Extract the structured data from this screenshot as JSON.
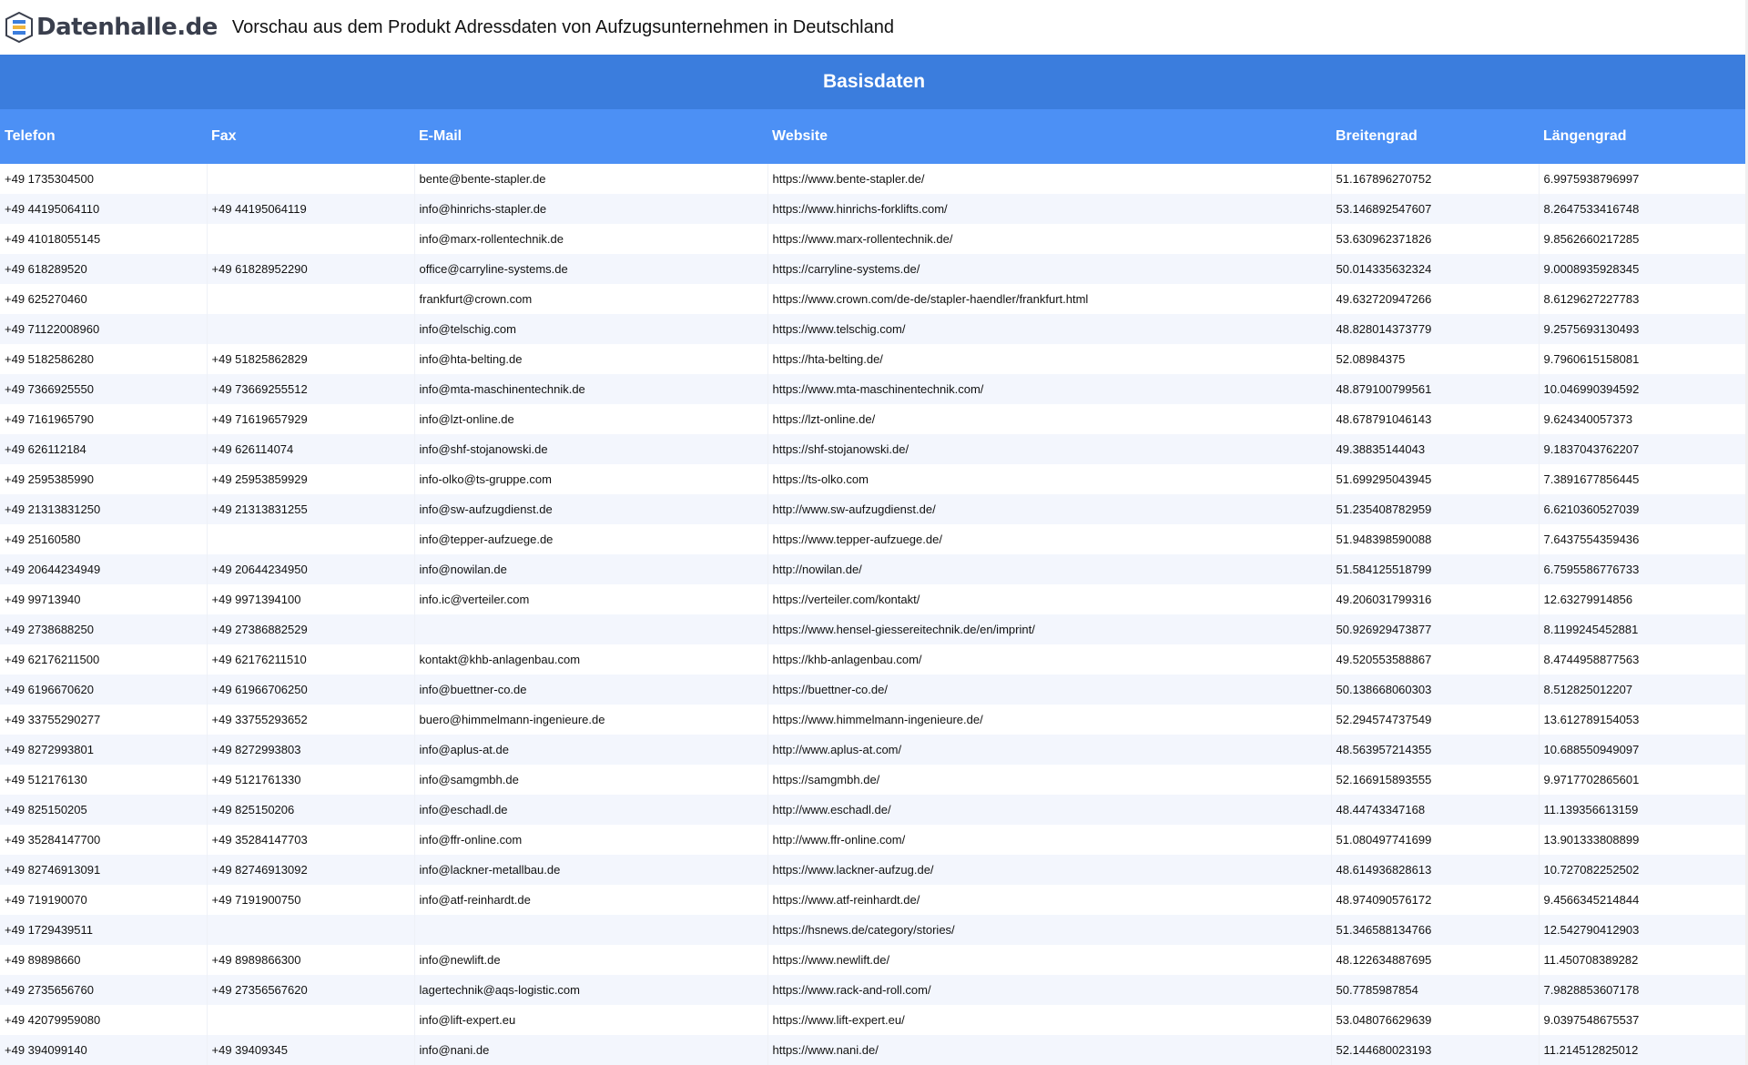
{
  "header": {
    "logo_text": "Datenhalle.de",
    "title": "Vorschau aus dem Produkt Adressdaten von Aufzugsunternehmen in Deutschland"
  },
  "section_title": "Basisdaten",
  "columns": [
    "Telefon",
    "Fax",
    "E-Mail",
    "Website",
    "Breitengrad",
    "Längengrad"
  ],
  "rows": [
    [
      "+49 1735304500",
      "",
      "bente@bente-stapler.de",
      "https://www.bente-stapler.de/",
      "51.167896270752",
      "6.9975938796997"
    ],
    [
      "+49 44195064110",
      "+49 44195064119",
      "info@hinrichs-stapler.de",
      "https://www.hinrichs-forklifts.com/",
      "53.146892547607",
      "8.2647533416748"
    ],
    [
      "+49 41018055145",
      "",
      "info@marx-rollentechnik.de",
      "https://www.marx-rollentechnik.de/",
      "53.630962371826",
      "9.8562660217285"
    ],
    [
      "+49 618289520",
      "+49 61828952290",
      "office@carryline-systems.de",
      "https://carryline-systems.de/",
      "50.014335632324",
      "9.0008935928345"
    ],
    [
      "+49 625270460",
      "",
      "frankfurt@crown.com",
      "https://www.crown.com/de-de/stapler-haendler/frankfurt.html",
      "49.632720947266",
      "8.6129627227783"
    ],
    [
      "+49 71122008960",
      "",
      "info@telschig.com",
      "https://www.telschig.com/",
      "48.828014373779",
      "9.2575693130493"
    ],
    [
      "+49 5182586280",
      "+49 51825862829",
      "info@hta-belting.de",
      "https://hta-belting.de/",
      "52.08984375",
      "9.7960615158081"
    ],
    [
      "+49 7366925550",
      "+49 73669255512",
      "info@mta-maschinentechnik.de",
      "https://www.mta-maschinentechnik.com/",
      "48.879100799561",
      "10.046990394592"
    ],
    [
      "+49 7161965790",
      "+49 71619657929",
      "info@lzt-online.de",
      "https://lzt-online.de/",
      "48.678791046143",
      "9.624340057373"
    ],
    [
      "+49 626112184",
      "+49 626114074",
      "info@shf-stojanowski.de",
      "https://shf-stojanowski.de/",
      "49.38835144043",
      "9.1837043762207"
    ],
    [
      "+49 2595385990",
      "+49 25953859929",
      "info-olko@ts-gruppe.com",
      "https://ts-olko.com",
      "51.699295043945",
      "7.3891677856445"
    ],
    [
      "+49 21313831250",
      "+49 21313831255",
      "info@sw-aufzugdienst.de",
      "http://www.sw-aufzugdienst.de/",
      "51.235408782959",
      "6.6210360527039"
    ],
    [
      "+49 25160580",
      "",
      "info@tepper-aufzuege.de",
      "https://www.tepper-aufzuege.de/",
      "51.948398590088",
      "7.6437554359436"
    ],
    [
      "+49 20644234949",
      "+49 20644234950",
      "info@nowilan.de",
      "http://nowilan.de/",
      "51.584125518799",
      "6.7595586776733"
    ],
    [
      "+49 99713940",
      "+49 9971394100",
      "info.ic@verteiler.com",
      "https://verteiler.com/kontakt/",
      "49.206031799316",
      "12.63279914856"
    ],
    [
      "+49 2738688250",
      "+49 27386882529",
      "",
      "https://www.hensel-giessereitechnik.de/en/imprint/",
      "50.926929473877",
      "8.1199245452881"
    ],
    [
      "+49 62176211500",
      "+49 62176211510",
      "kontakt@khb-anlagenbau.com",
      "https://khb-anlagenbau.com/",
      "49.520553588867",
      "8.4744958877563"
    ],
    [
      "+49 6196670620",
      "+49 61966706250",
      "info@buettner-co.de",
      "https://buettner-co.de/",
      "50.138668060303",
      "8.512825012207"
    ],
    [
      "+49 33755290277",
      "+49 33755293652",
      "buero@himmelmann-ingenieure.de",
      "https://www.himmelmann-ingenieure.de/",
      "52.294574737549",
      "13.612789154053"
    ],
    [
      "+49 8272993801",
      "+49 8272993803",
      "info@aplus-at.de",
      "http://www.aplus-at.com/",
      "48.563957214355",
      "10.688550949097"
    ],
    [
      "+49 512176130",
      "+49 5121761330",
      "info@samgmbh.de",
      "https://samgmbh.de/",
      "52.166915893555",
      "9.9717702865601"
    ],
    [
      "+49 825150205",
      "+49 825150206",
      "info@eschadl.de",
      "http://www.eschadl.de/",
      "48.44743347168",
      "11.139356613159"
    ],
    [
      "+49 35284147700",
      "+49 35284147703",
      "info@ffr-online.com",
      "http://www.ffr-online.com/",
      "51.080497741699",
      "13.901333808899"
    ],
    [
      "+49 82746913091",
      "+49 82746913092",
      "info@lackner-metallbau.de",
      "https://www.lackner-aufzug.de/",
      "48.614936828613",
      "10.727082252502"
    ],
    [
      "+49 719190070",
      "+49 7191900750",
      "info@atf-reinhardt.de",
      "https://www.atf-reinhardt.de/",
      "48.974090576172",
      "9.4566345214844"
    ],
    [
      "+49 1729439511",
      "",
      "",
      "https://hsnews.de/category/stories/",
      "51.346588134766",
      "12.542790412903"
    ],
    [
      "+49 89898660",
      "+49 8989866300",
      "info@newlift.de",
      "https://www.newlift.de/",
      "48.122634887695",
      "11.450708389282"
    ],
    [
      "+49 2735656760",
      "+49 27356567620",
      "lagertechnik@aqs-logistic.com",
      "https://www.rack-and-roll.com/",
      "50.7785987854",
      "7.9828853607178"
    ],
    [
      "+49 42079959080",
      "",
      "info@lift-expert.eu",
      "https://www.lift-expert.eu/",
      "53.048076629639",
      "9.0397548675537"
    ],
    [
      "+49 394099140",
      "+49 39409345",
      "info@nani.de",
      "https://www.nani.de/",
      "52.144680023193",
      "11.214512825012"
    ]
  ]
}
